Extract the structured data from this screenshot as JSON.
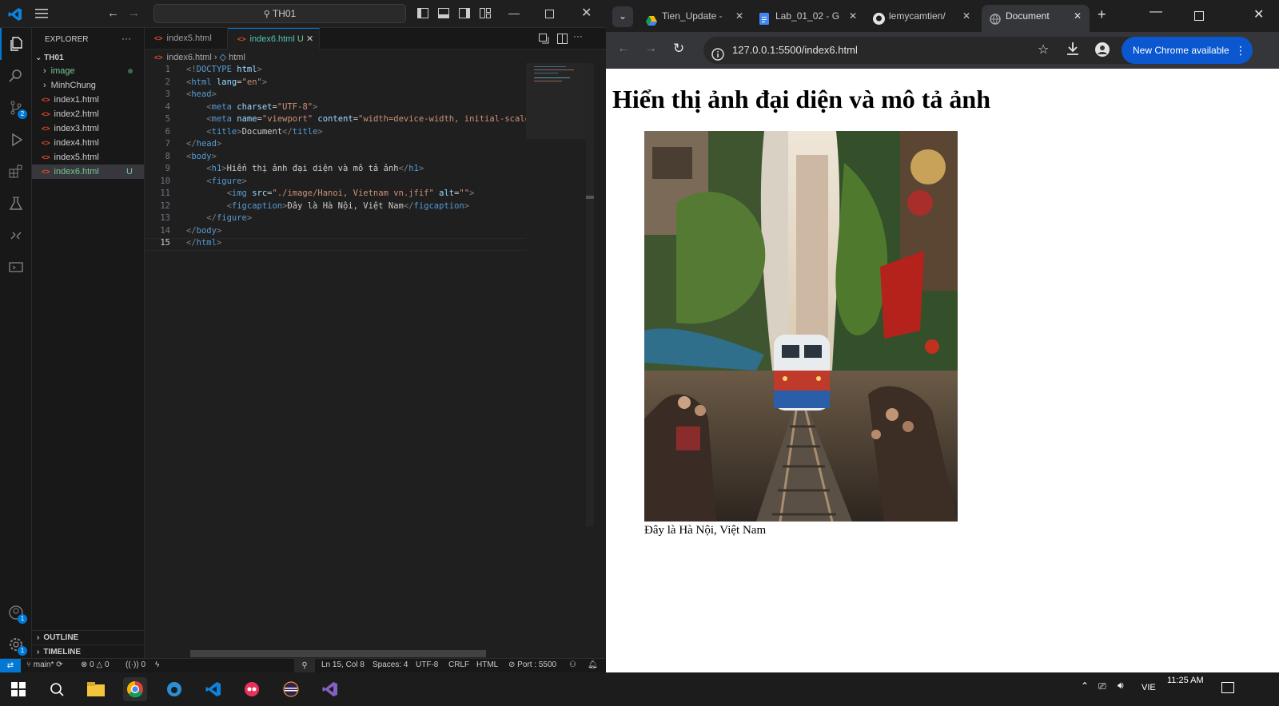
{
  "vscode": {
    "search_text": "TH01",
    "sidebar": {
      "explorer_title": "EXPLORER",
      "more": "···",
      "workspace": "TH01",
      "items": [
        {
          "label": "image",
          "type": "folder"
        },
        {
          "label": "MinhChung",
          "type": "folder"
        },
        {
          "label": "index1.html",
          "type": "file"
        },
        {
          "label": "index2.html",
          "type": "file"
        },
        {
          "label": "index3.html",
          "type": "file"
        },
        {
          "label": "index4.html",
          "type": "file"
        },
        {
          "label": "index5.html",
          "type": "file"
        },
        {
          "label": "index6.html",
          "type": "file",
          "status": "U"
        }
      ],
      "outline": "OUTLINE",
      "timeline": "TIMELINE"
    },
    "activity_badges": {
      "source_control": "2",
      "accounts": "1",
      "settings": "1"
    },
    "tabs": [
      {
        "label": "index5.html"
      },
      {
        "label": "index6.html",
        "status": "U"
      }
    ],
    "breadcrumb": {
      "file": "index6.html",
      "symbol": "html"
    },
    "code_lines": [
      {
        "n": "1",
        "parts": [
          [
            "p",
            "<!"
          ],
          [
            "t",
            "DOCTYPE"
          ],
          [
            "x",
            " "
          ],
          [
            "a",
            "html"
          ],
          [
            "p",
            ">"
          ]
        ]
      },
      {
        "n": "2",
        "parts": [
          [
            "p",
            "<"
          ],
          [
            "t",
            "html"
          ],
          [
            "x",
            " "
          ],
          [
            "a",
            "lang"
          ],
          [
            "x",
            "="
          ],
          [
            "s",
            "\"en\""
          ],
          [
            "p",
            ">"
          ]
        ]
      },
      {
        "n": "3",
        "parts": [
          [
            "p",
            "<"
          ],
          [
            "t",
            "head"
          ],
          [
            "p",
            ">"
          ]
        ]
      },
      {
        "n": "4",
        "parts": [
          [
            "x",
            "    "
          ],
          [
            "p",
            "<"
          ],
          [
            "t",
            "meta"
          ],
          [
            "x",
            " "
          ],
          [
            "a",
            "charset"
          ],
          [
            "x",
            "="
          ],
          [
            "s",
            "\"UTF-8\""
          ],
          [
            "p",
            ">"
          ]
        ]
      },
      {
        "n": "5",
        "parts": [
          [
            "x",
            "    "
          ],
          [
            "p",
            "<"
          ],
          [
            "t",
            "meta"
          ],
          [
            "x",
            " "
          ],
          [
            "a",
            "name"
          ],
          [
            "x",
            "="
          ],
          [
            "s",
            "\"viewport\""
          ],
          [
            "x",
            " "
          ],
          [
            "a",
            "content"
          ],
          [
            "x",
            "="
          ],
          [
            "s",
            "\"width=device-width, initial-scale"
          ]
        ]
      },
      {
        "n": "6",
        "parts": [
          [
            "x",
            "    "
          ],
          [
            "p",
            "<"
          ],
          [
            "t",
            "title"
          ],
          [
            "p",
            ">"
          ],
          [
            "x",
            "Document"
          ],
          [
            "p",
            "</"
          ],
          [
            "t",
            "title"
          ],
          [
            "p",
            ">"
          ]
        ]
      },
      {
        "n": "7",
        "parts": [
          [
            "p",
            "</"
          ],
          [
            "t",
            "head"
          ],
          [
            "p",
            ">"
          ]
        ]
      },
      {
        "n": "8",
        "parts": [
          [
            "p",
            "<"
          ],
          [
            "t",
            "body"
          ],
          [
            "p",
            ">"
          ]
        ]
      },
      {
        "n": "9",
        "parts": [
          [
            "x",
            "    "
          ],
          [
            "p",
            "<"
          ],
          [
            "t",
            "h1"
          ],
          [
            "p",
            ">"
          ],
          [
            "x",
            "Hiển thị ảnh đại diện và mô tả ảnh"
          ],
          [
            "p",
            "</"
          ],
          [
            "t",
            "h1"
          ],
          [
            "p",
            ">"
          ]
        ]
      },
      {
        "n": "10",
        "parts": [
          [
            "x",
            "    "
          ],
          [
            "p",
            "<"
          ],
          [
            "t",
            "figure"
          ],
          [
            "p",
            ">"
          ]
        ]
      },
      {
        "n": "11",
        "parts": [
          [
            "x",
            "        "
          ],
          [
            "p",
            "<"
          ],
          [
            "t",
            "img"
          ],
          [
            "x",
            " "
          ],
          [
            "a",
            "src"
          ],
          [
            "x",
            "="
          ],
          [
            "s",
            "\"./image/Hanoi, Vietnam vn.jfif\""
          ],
          [
            "x",
            " "
          ],
          [
            "a",
            "alt"
          ],
          [
            "x",
            "="
          ],
          [
            "s",
            "\"\""
          ],
          [
            "p",
            ">"
          ]
        ]
      },
      {
        "n": "12",
        "parts": [
          [
            "x",
            "        "
          ],
          [
            "p",
            "<"
          ],
          [
            "t",
            "figcaption"
          ],
          [
            "p",
            ">"
          ],
          [
            "x",
            "Đây là Hà Nội, Việt Nam"
          ],
          [
            "p",
            "</"
          ],
          [
            "t",
            "figcaption"
          ],
          [
            "p",
            ">"
          ]
        ]
      },
      {
        "n": "13",
        "parts": [
          [
            "x",
            "    "
          ],
          [
            "p",
            "</"
          ],
          [
            "t",
            "figure"
          ],
          [
            "p",
            ">"
          ]
        ]
      },
      {
        "n": "14",
        "parts": [
          [
            "p",
            "</"
          ],
          [
            "t",
            "body"
          ],
          [
            "p",
            ">"
          ]
        ]
      },
      {
        "n": "15",
        "parts": [
          [
            "p",
            "</"
          ],
          [
            "t",
            "html"
          ],
          [
            "p",
            ">"
          ]
        ]
      }
    ],
    "status": {
      "branch": "main*",
      "errors": "0",
      "warnings": "0",
      "ports": "0",
      "position": "Ln 15, Col 8",
      "spaces": "Spaces: 4",
      "encoding": "UTF-8",
      "eol": "CRLF",
      "language": "HTML",
      "port": "Port : 5500"
    }
  },
  "chrome": {
    "tabs": [
      {
        "label": "Tien_Update -"
      },
      {
        "label": "Lab_01_02 - G"
      },
      {
        "label": "lemycamtien/"
      },
      {
        "label": "Document"
      }
    ],
    "url": "127.0.0.1:5500/index6.html",
    "update_label": "New Chrome available",
    "page": {
      "heading": "Hiển thị ảnh đại diện và mô tả ảnh",
      "caption": "Đây là Hà Nội, Việt Nam"
    }
  },
  "taskbar": {
    "lang": "VIE",
    "time": "11:25 AM"
  },
  "colors": {
    "accent": "#0078d4",
    "chrome_update": "#0b57d0",
    "html_icon": "#e44d26",
    "untracked": "#73c991"
  }
}
